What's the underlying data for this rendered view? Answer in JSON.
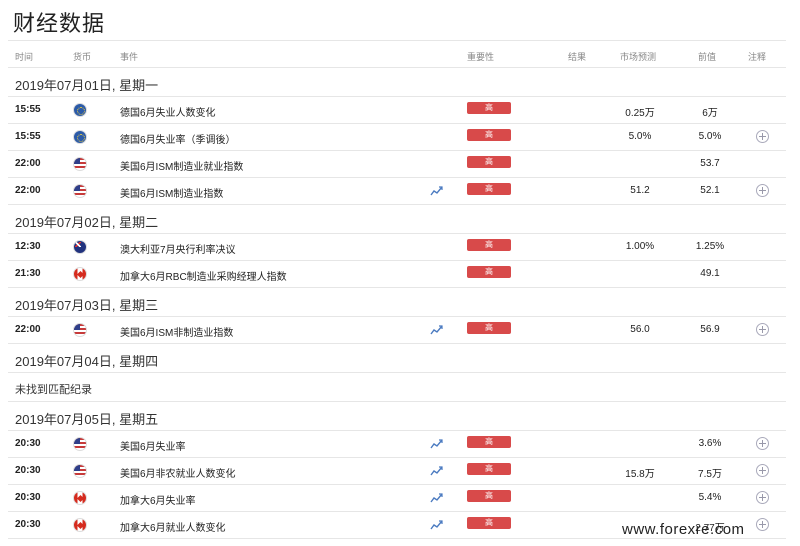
{
  "page_title": "财经数据",
  "headers": {
    "time": "时间",
    "currency": "货币",
    "event": "事件",
    "importance": "重要性",
    "result": "结果",
    "forecast": "市场预测",
    "previous": "前值",
    "note": "注释"
  },
  "importance_label": "高",
  "colors": {
    "importance_high": "#d84a4a",
    "border": "#e6e6e6"
  },
  "days": [
    {
      "label": "2019年07月01日, 星期一",
      "events": [
        {
          "time": "15:55",
          "flag": "eu-flag-icon",
          "event": "德国6月失业人数变化",
          "chart": false,
          "forecast": "0.25万",
          "previous": "6万",
          "note": false
        },
        {
          "time": "15:55",
          "flag": "eu-flag-icon",
          "event": "德国6月失业率（季调後）",
          "chart": false,
          "forecast": "5.0%",
          "previous": "5.0%",
          "note": true
        },
        {
          "time": "22:00",
          "flag": "us-flag-icon",
          "event": "美国6月ISM制造业就业指数",
          "chart": false,
          "forecast": "",
          "previous": "53.7",
          "note": false
        },
        {
          "time": "22:00",
          "flag": "us-flag-icon",
          "event": "美国6月ISM制造业指数",
          "chart": true,
          "forecast": "51.2",
          "previous": "52.1",
          "note": true
        }
      ]
    },
    {
      "label": "2019年07月02日, 星期二",
      "events": [
        {
          "time": "12:30",
          "flag": "au-flag-icon",
          "event": "澳大利亚7月央行利率决议",
          "chart": false,
          "forecast": "1.00%",
          "previous": "1.25%",
          "note": false
        },
        {
          "time": "21:30",
          "flag": "ca-flag-icon",
          "event": "加拿大6月RBC制造业采购经理人指数",
          "chart": false,
          "forecast": "",
          "previous": "49.1",
          "note": false
        }
      ]
    },
    {
      "label": "2019年07月03日, 星期三",
      "events": [
        {
          "time": "22:00",
          "flag": "us-flag-icon",
          "event": "美国6月ISM非制造业指数",
          "chart": true,
          "forecast": "56.0",
          "previous": "56.9",
          "note": true
        }
      ]
    },
    {
      "label": "2019年07月04日, 星期四",
      "empty": "未找到匹配纪录",
      "events": []
    },
    {
      "label": "2019年07月05日, 星期五",
      "events": [
        {
          "time": "20:30",
          "flag": "us-flag-icon",
          "event": "美国6月失业率",
          "chart": true,
          "forecast": "",
          "previous": "3.6%",
          "note": true
        },
        {
          "time": "20:30",
          "flag": "us-flag-icon",
          "event": "美国6月非农就业人数变化",
          "chart": true,
          "forecast": "15.8万",
          "previous": "7.5万",
          "note": true
        },
        {
          "time": "20:30",
          "flag": "ca-flag-icon",
          "event": "加拿大6月失业率",
          "chart": true,
          "forecast": "",
          "previous": "5.4%",
          "note": true
        },
        {
          "time": "20:30",
          "flag": "ca-flag-icon",
          "event": "加拿大6月就业人数变化",
          "chart": true,
          "forecast": "",
          "previous": "2.77万",
          "note": true
        }
      ]
    }
  ],
  "watermark": "www.forexre.com"
}
